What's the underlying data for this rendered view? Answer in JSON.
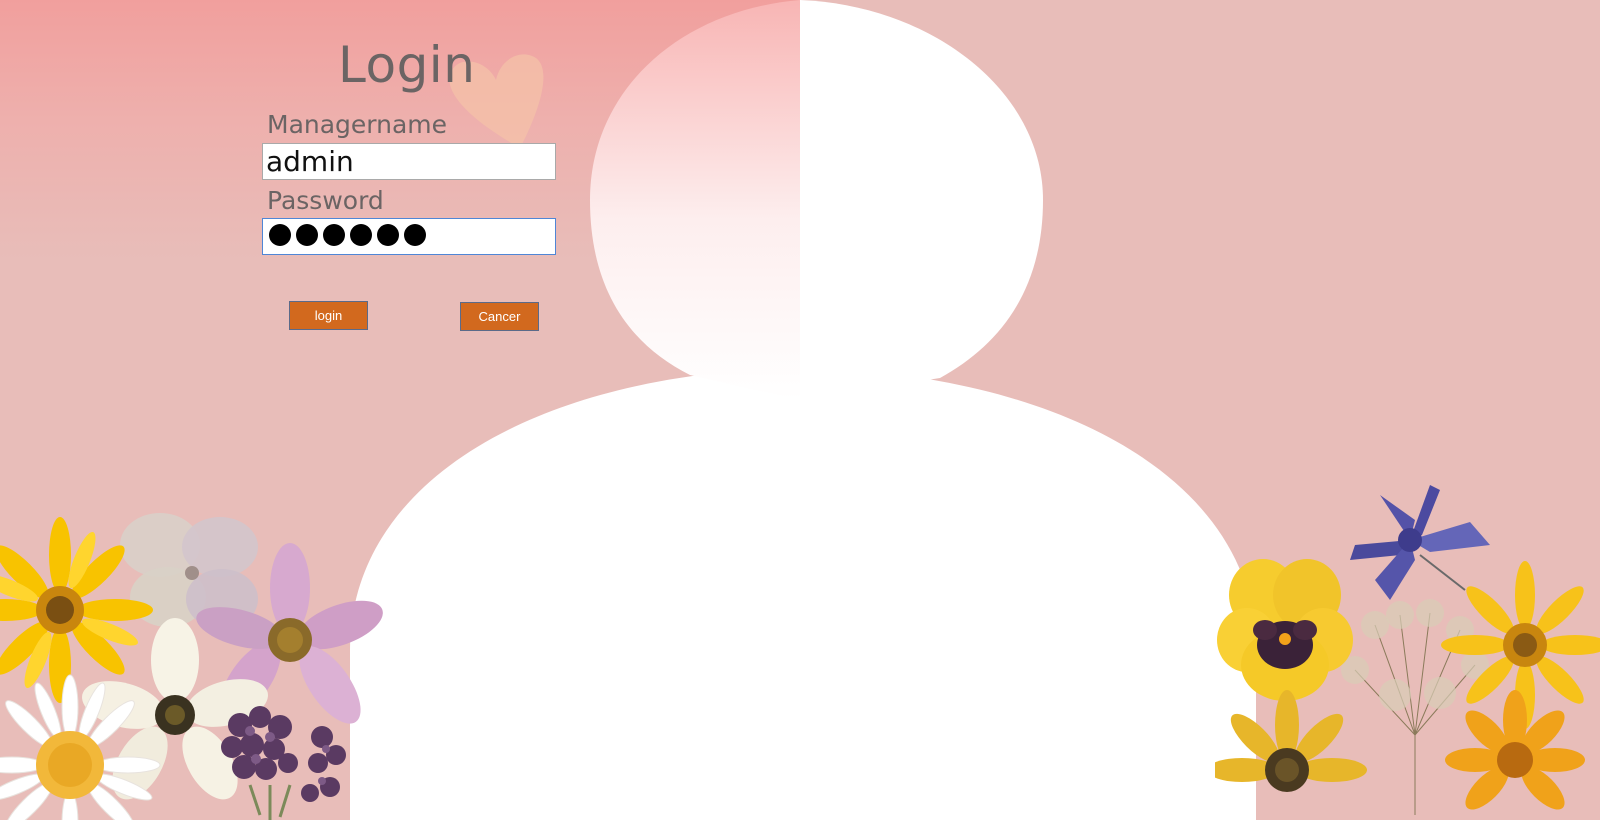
{
  "login_form": {
    "title": "Login",
    "username_label": "Managername",
    "username_value": "admin",
    "password_label": "Password",
    "password_dot_count": 6,
    "login_button": "login",
    "cancel_button": "Cancer"
  },
  "colors": {
    "background_top": "#f19f9d",
    "background": "#e8bdb9",
    "silhouette": "#ffffff",
    "button": "#d2691e",
    "text": "#6b6464",
    "password_focus_border": "#4f86d6"
  },
  "icons": {
    "heart": "heart-icon",
    "silhouette": "person-silhouette-icon"
  }
}
